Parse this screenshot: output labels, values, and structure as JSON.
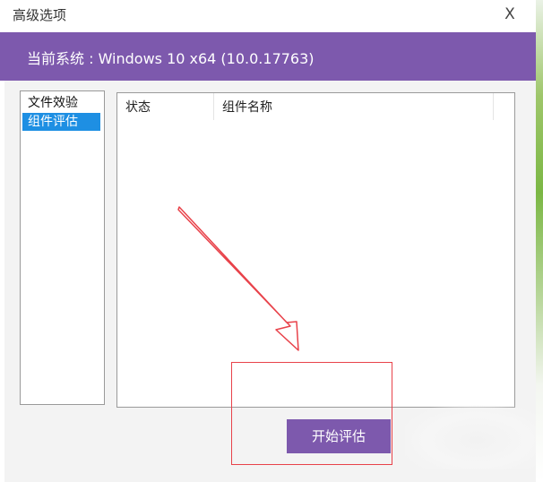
{
  "window": {
    "title": "高级选项",
    "close_glyph": "X"
  },
  "header": {
    "system_info": "当前系统 : Windows 10 x64 (10.0.17763)",
    "accent_color": "#7d59ad"
  },
  "sidebar": {
    "items": [
      {
        "label": "文件效验",
        "selected": false
      },
      {
        "label": "组件评估",
        "selected": true
      }
    ],
    "selection_color": "#1e8fe3"
  },
  "table": {
    "columns": [
      "状态",
      "组件名称"
    ],
    "rows": []
  },
  "actions": {
    "start_label": "开始评估"
  },
  "annotation": {
    "color": "#e8424a",
    "icon": "arrow-icon"
  }
}
